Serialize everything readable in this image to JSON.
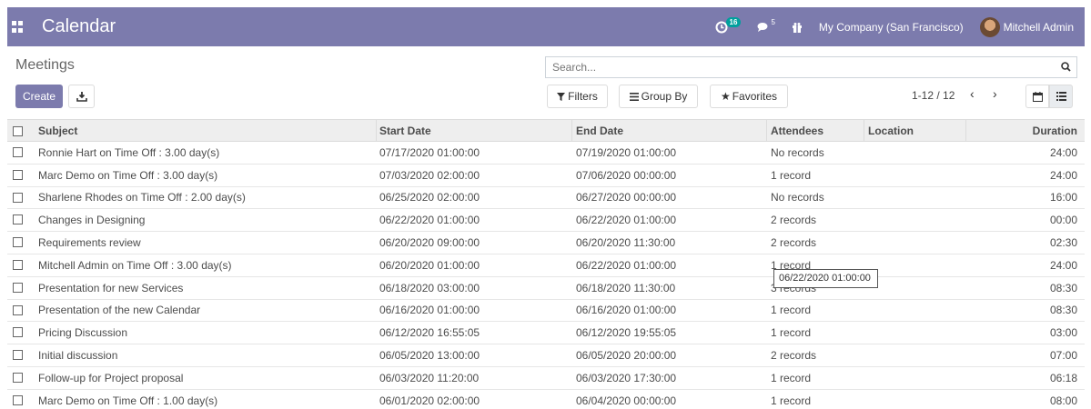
{
  "navbar": {
    "app_title": "Calendar",
    "activity_count": "16",
    "messages_count": "5",
    "company": "My Company (San Francisco)",
    "user": "Mitchell Admin",
    "bg_color": "#7c7bad"
  },
  "control_panel": {
    "title": "Meetings",
    "create_label": "Create",
    "search_placeholder": "Search...",
    "filters_label": "Filters",
    "group_by_label": "Group By",
    "favorites_label": "Favorites",
    "pager": "1-12 / 12"
  },
  "table": {
    "headers": {
      "subject": "Subject",
      "start": "Start Date",
      "end": "End Date",
      "attendees": "Attendees",
      "location": "Location",
      "duration": "Duration"
    },
    "rows": [
      {
        "subject": "Ronnie Hart on Time Off : 3.00 day(s)",
        "start": "07/17/2020 01:00:00",
        "end": "07/19/2020 01:00:00",
        "attendees": "No records",
        "location": "",
        "duration": "24:00"
      },
      {
        "subject": "Marc Demo on Time Off : 3.00 day(s)",
        "start": "07/03/2020 02:00:00",
        "end": "07/06/2020 00:00:00",
        "attendees": "1 record",
        "location": "",
        "duration": "24:00"
      },
      {
        "subject": "Sharlene Rhodes on Time Off : 2.00 day(s)",
        "start": "06/25/2020 02:00:00",
        "end": "06/27/2020 00:00:00",
        "attendees": "No records",
        "location": "",
        "duration": "16:00"
      },
      {
        "subject": "Changes in Designing",
        "start": "06/22/2020 01:00:00",
        "end": "06/22/2020 01:00:00",
        "attendees": "2 records",
        "location": "",
        "duration": "00:00"
      },
      {
        "subject": "Requirements review",
        "start": "06/20/2020 09:00:00",
        "end": "06/20/2020 11:30:00",
        "attendees": "2 records",
        "location": "",
        "duration": "02:30"
      },
      {
        "subject": "Mitchell Admin on Time Off : 3.00 day(s)",
        "start": "06/20/2020 01:00:00",
        "end": "06/22/2020 01:00:00",
        "attendees": "1 record",
        "location": "",
        "duration": "24:00"
      },
      {
        "subject": "Presentation for new Services",
        "start": "06/18/2020 03:00:00",
        "end": "06/18/2020 11:30:00",
        "attendees": "3 records",
        "location": "",
        "duration": "08:30"
      },
      {
        "subject": "Presentation of the new Calendar",
        "start": "06/16/2020 01:00:00",
        "end": "06/16/2020 01:00:00",
        "attendees": "1 record",
        "location": "",
        "duration": "08:30"
      },
      {
        "subject": "Pricing Discussion",
        "start": "06/12/2020 16:55:05",
        "end": "06/12/2020 19:55:05",
        "attendees": "1 record",
        "location": "",
        "duration": "03:00"
      },
      {
        "subject": "Initial discussion",
        "start": "06/05/2020 13:00:00",
        "end": "06/05/2020 20:00:00",
        "attendees": "2 records",
        "location": "",
        "duration": "07:00"
      },
      {
        "subject": "Follow-up for Project proposal",
        "start": "06/03/2020 11:20:00",
        "end": "06/03/2020 17:30:00",
        "attendees": "1 record",
        "location": "",
        "duration": "06:18"
      },
      {
        "subject": "Marc Demo on Time Off : 1.00 day(s)",
        "start": "06/01/2020 02:00:00",
        "end": "06/04/2020 00:00:00",
        "attendees": "1 record",
        "location": "",
        "duration": "08:00"
      }
    ]
  },
  "tooltip": "06/22/2020 01:00:00"
}
